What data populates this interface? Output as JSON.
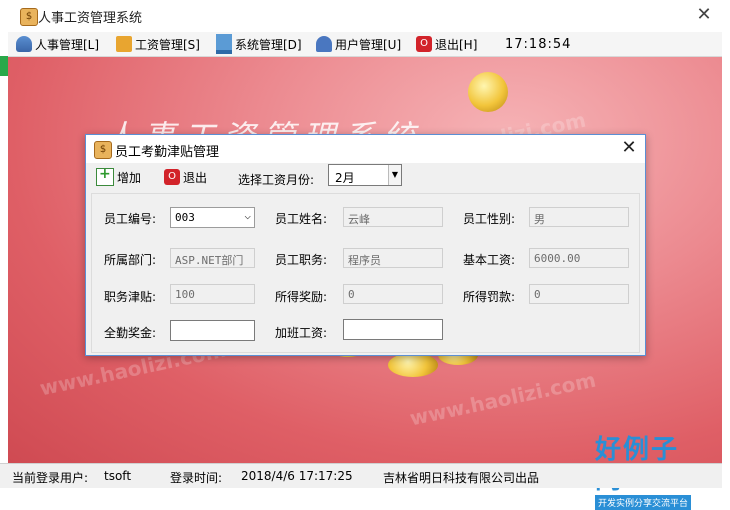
{
  "app": {
    "title": "人事工资管理系统"
  },
  "menu": {
    "items": [
      {
        "label": "人事管理[L]",
        "icon": "personnel-icon"
      },
      {
        "label": "工资管理[S]",
        "icon": "salary-icon"
      },
      {
        "label": "系统管理[D]",
        "icon": "system-icon"
      },
      {
        "label": "用户管理[U]",
        "icon": "user-icon"
      },
      {
        "label": "退出[H]",
        "icon": "exit-icon"
      }
    ],
    "clock": "17:18:54"
  },
  "background": {
    "banner": "人事工资管理系统",
    "watermark": "www.haolizi.com"
  },
  "dialog": {
    "title": "员工考勤津贴管理",
    "toolbar": {
      "add_label": "增加",
      "exit_label": "退出",
      "month_label": "选择工资月份:",
      "month_value": "2月"
    },
    "fields": {
      "emp_no_label": "员工编号:",
      "emp_no_value": "003",
      "name_label": "员工姓名:",
      "name_value": "云峰",
      "gender_label": "员工性别:",
      "gender_value": "男",
      "dept_label": "所属部门:",
      "dept_value": "ASP.NET部门",
      "position_label": "员工职务:",
      "position_value": "程序员",
      "base_label": "基本工资:",
      "base_value": "6000.00",
      "allowance_label": "职务津贴:",
      "allowance_value": "100",
      "bonus_label": "所得奖励:",
      "bonus_value": "0",
      "penalty_label": "所得罚款:",
      "penalty_value": "0",
      "attendance_label": "全勤奖金:",
      "attendance_value": "",
      "overtime_label": "加班工资:",
      "overtime_value": ""
    }
  },
  "statusbar": {
    "user_label": "当前登录用户:",
    "user_value": "tsoft",
    "time_label": "登录时间:",
    "time_value": "2018/4/6 17:17:25",
    "company": "吉林省明日科技有限公司出品"
  },
  "logo": {
    "text": "好例子网",
    "tagline": "开发实例分享交流平台"
  }
}
